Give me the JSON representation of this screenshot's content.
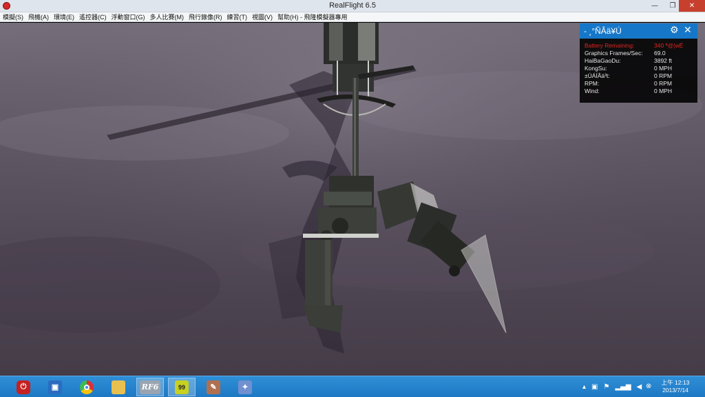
{
  "window": {
    "title": "RealFlight 6.5",
    "minimize_icon": "minimize-icon",
    "restore_icon": "restore-icon",
    "close_icon": "close-icon"
  },
  "menu": [
    "模擬(S)",
    "飛機(A)",
    "環境(E)",
    "遙控器(C)",
    "浮動窗口(G)",
    "多人比賽(M)",
    "飛行錄像(R)",
    "練習(T)",
    "視圖(V)",
    "幫助(H) - 飛隆模擬器專用"
  ],
  "panel": {
    "title": "- ¸°ÑÂä¥Ú",
    "settings_icon": "gear-icon",
    "close_icon": "close-icon",
    "rows": [
      {
        "label": "Battery Remaining:",
        "value": "340 ª@¦wÉ",
        "warn": true
      },
      {
        "label": "Graphics Frames/Sec:",
        "value": "69.0",
        "warn": false
      },
      {
        "label": "HaiBaGaoDu:",
        "value": "3892 ft",
        "warn": false
      },
      {
        "label": "KongSu:",
        "value": "0 MPH",
        "warn": false
      },
      {
        "label": "±ÚÁÍÂä³t:",
        "value": "0 RPM",
        "warn": false
      },
      {
        "label": "RPM:",
        "value": "0 RPM",
        "warn": false
      },
      {
        "label": "Wind:",
        "value": "0 MPH",
        "warn": false
      }
    ]
  },
  "taskbar": {
    "apps": [
      {
        "name": "shutdown",
        "icon": "power-icon",
        "color": "#c62020"
      },
      {
        "name": "app-blue",
        "icon": "app-icon",
        "color": "#2b6cc0"
      },
      {
        "name": "chrome",
        "icon": "chrome-icon",
        "color": "#e2a21b"
      },
      {
        "name": "explorer",
        "icon": "folder-icon",
        "color": "#e8c050"
      },
      {
        "name": "realflight",
        "icon": "rf-icon",
        "color": "#9aa4b0",
        "text": "RF6"
      },
      {
        "name": "monitor",
        "icon": "monitor-icon",
        "color": "#c8d020",
        "text": "99"
      },
      {
        "name": "tool",
        "icon": "tool-icon",
        "color": "#b07050"
      },
      {
        "name": "paint",
        "icon": "paint-icon",
        "color": "#7090d0"
      }
    ],
    "clock_time": "上午 12:13",
    "clock_date": "2013/7/14"
  }
}
